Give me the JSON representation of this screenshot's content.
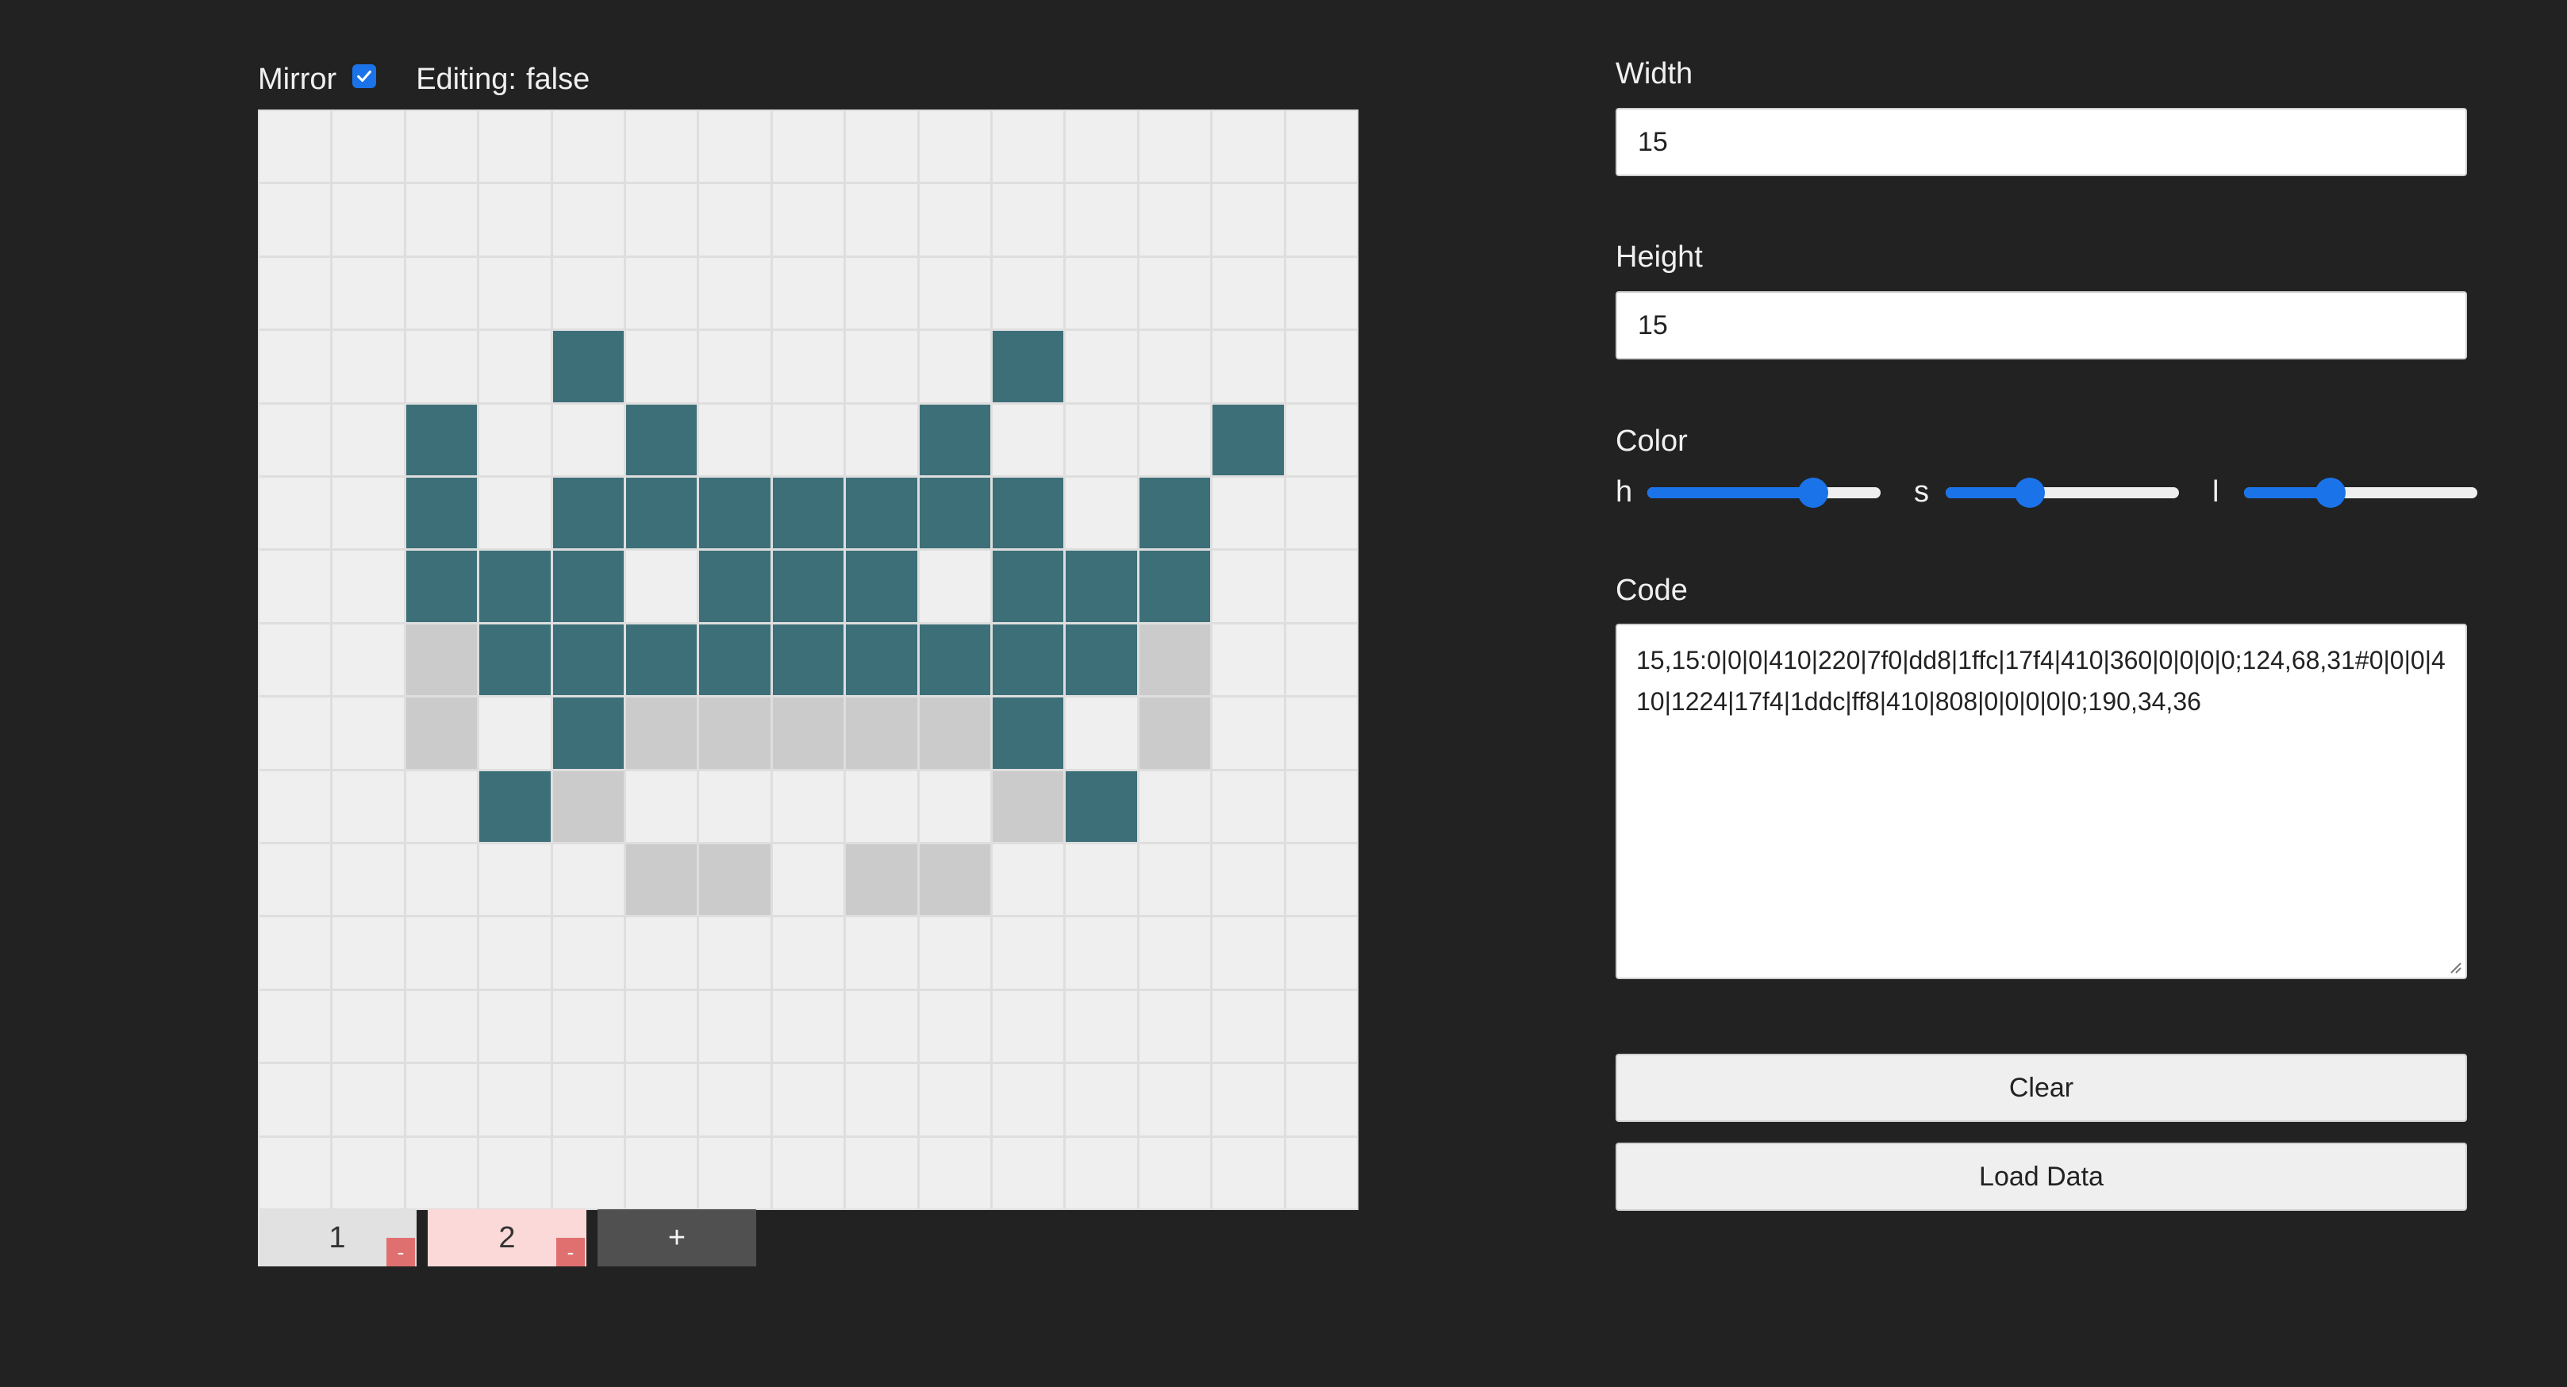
{
  "toolbar": {
    "mirror_label": "Mirror",
    "mirror_checked": true,
    "editing_label": "Editing:",
    "editing_value": "false"
  },
  "grid": {
    "columns": 15,
    "rows": 15,
    "active_color": "#3d6f79",
    "ghost_color": "#cbcbcb",
    "empty_color": "#efefef",
    "pixels": [
      "...............",
      "...............",
      "...............",
      "....#.....#....",
      "..#..#...#...#.",
      "..#.#######.#..",
      "..###.###.###..",
      "..g#########g..",
      "..g.#ggggg#.g..",
      "...#g.....g#...",
      ".....gg.gg.....",
      "...............",
      "...............",
      "...............",
      "..............."
    ]
  },
  "frames": {
    "tabs": [
      {
        "label": "1",
        "remove_label": "-"
      },
      {
        "label": "2",
        "remove_label": "-"
      }
    ],
    "add_label": "+"
  },
  "settings": {
    "width_label": "Width",
    "width_value": "15",
    "height_label": "Height",
    "height_value": "15",
    "color_label": "Color",
    "sliders": [
      {
        "letter": "h",
        "value": 0.71
      },
      {
        "letter": "s",
        "value": 0.36
      },
      {
        "letter": "l",
        "value": 0.37
      }
    ],
    "code_label": "Code",
    "code_value": "15,15:0|0|0|410|220|7f0|dd8|1ffc|17f4|410|360|0|0|0|0;124,68,31#0|0|0|410|1224|17f4|1ddc|ff8|410|808|0|0|0|0|0;190,34,36",
    "clear_label": "Clear",
    "load_label": "Load Data"
  },
  "colors": {
    "accent": "#1a73e8",
    "background": "#222222",
    "remove": "#e07070",
    "frame_active": "#fcd9d9"
  }
}
